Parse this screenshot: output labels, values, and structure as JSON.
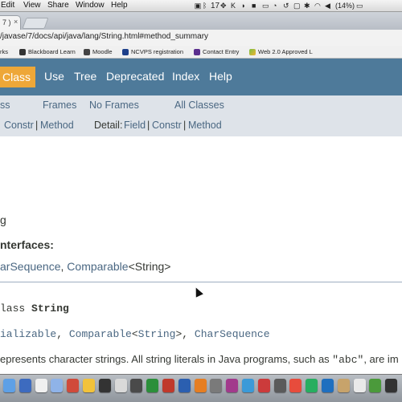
{
  "menubar": {
    "items": [
      "Edit",
      "View",
      "Share",
      "Window",
      "Help"
    ],
    "status_number": "17",
    "battery": "(14%)"
  },
  "tab": {
    "title": "7 )",
    "close": "×"
  },
  "url": "/javase/7/docs/api/java/lang/String.html#method_summary",
  "bookmarks": [
    "rks",
    "Blackboard Learn",
    "Moodle",
    "NCVPS registration",
    "Contact Entry",
    "Web 2.0 Approved L"
  ],
  "nav": {
    "class_label": "Class",
    "links": [
      "Use",
      "Tree",
      "Deprecated",
      "Index",
      "Help"
    ]
  },
  "subnav": {
    "row1": {
      "classes": "ss",
      "frames": "Frames",
      "noframes": "No Frames",
      "all": "All Classes"
    },
    "row2": {
      "constr": "Constr",
      "sep": "|",
      "method": "Method",
      "detail_label": "Detail:",
      "field": "Field",
      "constr2": "Constr",
      "method2": "Method"
    }
  },
  "content": {
    "g_line": "g",
    "interfaces_heading": "nterfaces:",
    "interfaces_list_a": "arSequence",
    "interfaces_list_sep": ",",
    "interfaces_list_b": "Comparable",
    "interfaces_list_c": "<String>",
    "class_decl_a": "lass",
    "class_decl_b": "String",
    "implements_a": "ializable",
    "implements_sep1": ",",
    "implements_b": "Comparable",
    "implements_c": "<String>",
    "implements_d": "String",
    "implements_sep2": ",",
    "implements_e": "CharSequence",
    "implements_f": ">",
    "desc_a": "epresents character strings. All string literals in Java programs, such as",
    "desc_code": "\"abc\"",
    "desc_b": ", are im"
  },
  "colors": {
    "nav_bg": "#4e7a9a",
    "active_tab": "#eea738",
    "subnav_bg": "#dee3e9",
    "link": "#4a6782"
  }
}
